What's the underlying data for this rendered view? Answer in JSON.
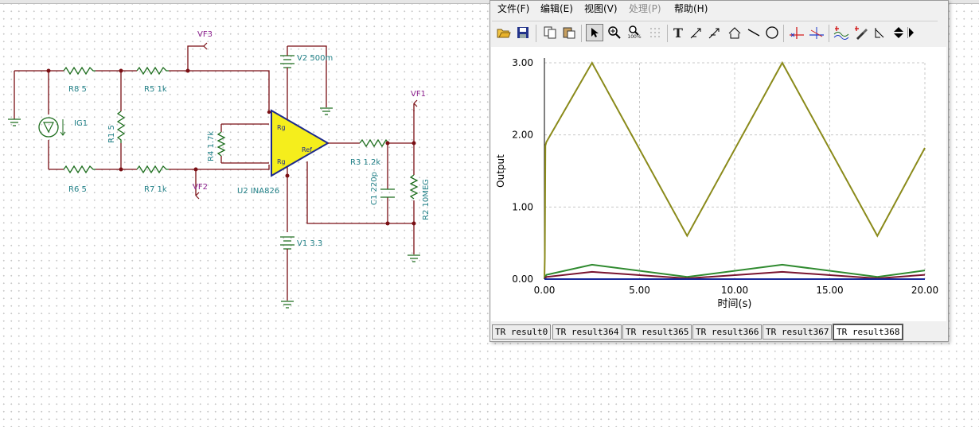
{
  "schematic": {
    "components": {
      "r8": "R8 5",
      "r5": "R5 1k",
      "r6": "R6 5",
      "r7": "R7 1k",
      "r1": "R1 5",
      "r4": "R4 1.7k",
      "r3": "R3 1.2k",
      "r2": "R2 10MEG",
      "c1": "C1 220p",
      "ig1": "IG1",
      "v2": "V2 500m",
      "v1": "V1 3.3",
      "u2": "U2 INA826"
    },
    "pins": {
      "rg_top": "Rg",
      "rg_bottom": "Rg",
      "ref": "Ref"
    },
    "probes": {
      "vf1": "VF1",
      "vf2": "VF2",
      "vf3": "VF3"
    }
  },
  "window": {
    "menu": [
      "文件(F)",
      "编辑(E)",
      "视图(V)",
      "处理(P)",
      "帮助(H)"
    ],
    "toolbar_icons": [
      "open-icon",
      "save-icon",
      "copy-icon",
      "paste-icon",
      "pointer-icon",
      "zoom-in-icon",
      "zoom-100-icon",
      "grid-icon",
      "text-icon",
      "cursor-a-icon",
      "cursor-b-icon",
      "cursor-ab-icon",
      "line-icon",
      "circle-icon",
      "marker-a-icon",
      "marker-b-icon",
      "curves-icon",
      "pick-icon",
      "step-icon",
      "nav-updown-icon",
      "nav-right-icon"
    ],
    "toolbar_labels": {
      "text": "T",
      "zoom_100": "100%"
    },
    "tabs": [
      "TR result0",
      "TR result364",
      "TR result365",
      "TR result366",
      "TR result367",
      "TR result368"
    ],
    "active_tab": "TR result368"
  },
  "chart_data": {
    "type": "line",
    "xlabel": "时间(s)",
    "ylabel": "Output",
    "xlim": [
      0,
      20
    ],
    "ylim": [
      0,
      3
    ],
    "xticks": [
      "0.00",
      "5.00",
      "10.00",
      "15.00",
      "20.00"
    ],
    "yticks": [
      "0.00",
      "1.00",
      "2.00",
      "3.00"
    ],
    "grid": true,
    "series": [
      {
        "color": "#8a8a1a",
        "x": [
          0,
          0.02,
          0.05,
          0.1,
          2.5,
          7.5,
          12.5,
          17.5,
          20
        ],
        "y": [
          0,
          0.3,
          1.85,
          1.9,
          3.0,
          0.6,
          3.0,
          0.6,
          1.82
        ]
      },
      {
        "color": "#2f8a2f",
        "x": [
          0,
          0.1,
          2.5,
          7.5,
          12.5,
          17.5,
          20
        ],
        "y": [
          0,
          0.06,
          0.2,
          0.03,
          0.2,
          0.03,
          0.12
        ]
      },
      {
        "color": "#7a1530",
        "x": [
          0,
          0.1,
          2.5,
          7.5,
          12.5,
          17.5,
          20
        ],
        "y": [
          0,
          0.03,
          0.1,
          0.01,
          0.1,
          0.01,
          0.06
        ]
      },
      {
        "color": "#1a2a9a",
        "x": [
          0,
          20
        ],
        "y": [
          0.0,
          0.0
        ]
      }
    ]
  }
}
